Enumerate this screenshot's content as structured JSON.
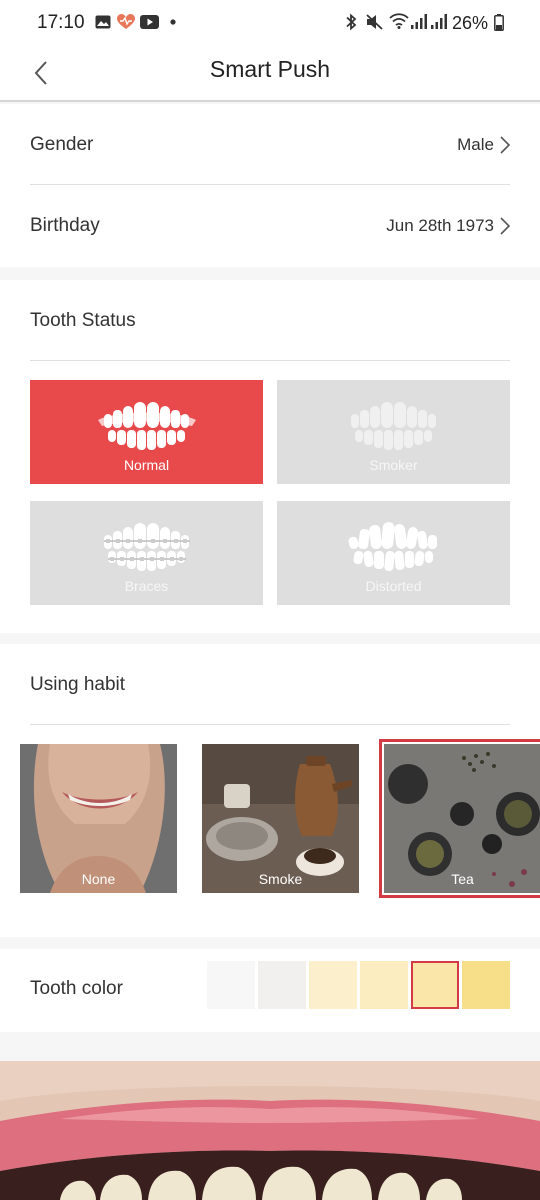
{
  "status_bar": {
    "time": "17:10",
    "battery": "26%",
    "left_icons": [
      "gallery-icon",
      "health-icon",
      "youtube-icon",
      "dot-icon"
    ],
    "right_icons": [
      "bluetooth-icon",
      "mute-icon",
      "wifi-icon",
      "signal-icon",
      "signal-icon",
      "battery-icon"
    ]
  },
  "header": {
    "title": "Smart Push",
    "back_icon": "chevron-left-icon"
  },
  "profile": {
    "gender_label": "Gender",
    "gender_value": "Male",
    "birthday_label": "Birthday",
    "birthday_value": "Jun 28th 1973"
  },
  "tooth_status": {
    "title": "Tooth Status",
    "options": [
      {
        "label": "Normal",
        "selected": true
      },
      {
        "label": "Smoker",
        "selected": false
      },
      {
        "label": "Braces",
        "selected": false
      },
      {
        "label": "Distorted",
        "selected": false
      }
    ]
  },
  "using_habit": {
    "title": "Using habit",
    "options": [
      {
        "label": "None",
        "selected": false
      },
      {
        "label": "Smoke",
        "selected": false
      },
      {
        "label": "Tea",
        "selected": true
      }
    ]
  },
  "tooth_color": {
    "title": "Tooth color",
    "swatches": [
      "#f7f7f7",
      "#f1f0ef",
      "#fcf0cc",
      "#fbedc0",
      "#fae6a8",
      "#f7df8a"
    ],
    "selected_index": 4
  },
  "colors": {
    "accent_red": "#e84a4c",
    "selected_outline": "#d23a44"
  }
}
